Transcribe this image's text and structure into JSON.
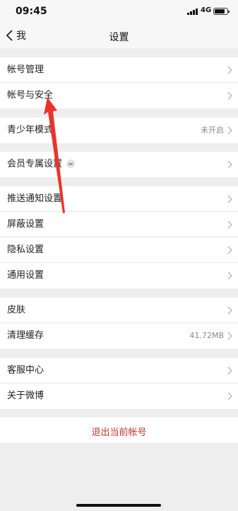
{
  "status_bar": {
    "time": "09:45",
    "network": "4G"
  },
  "nav": {
    "back_label": "我",
    "title": "设置"
  },
  "groups": [
    {
      "items": [
        {
          "label": "帐号管理"
        },
        {
          "label": "帐号与安全"
        }
      ]
    },
    {
      "items": [
        {
          "label": "青少年模式",
          "value": "未开启"
        }
      ]
    },
    {
      "items": [
        {
          "label": "会员专属设置"
        }
      ]
    },
    {
      "items": [
        {
          "label": "推送通知设置"
        },
        {
          "label": "屏蔽设置"
        },
        {
          "label": "隐私设置"
        },
        {
          "label": "通用设置"
        }
      ]
    },
    {
      "items": [
        {
          "label": "皮肤"
        },
        {
          "label": "清理缓存",
          "value": "41.72MB"
        }
      ]
    },
    {
      "items": [
        {
          "label": "客服中心"
        },
        {
          "label": "关于微博"
        }
      ]
    }
  ],
  "logout_label": "退出当前帐号",
  "colors": {
    "accent": "#c0392b",
    "annotation_arrow": "#e8352b"
  }
}
